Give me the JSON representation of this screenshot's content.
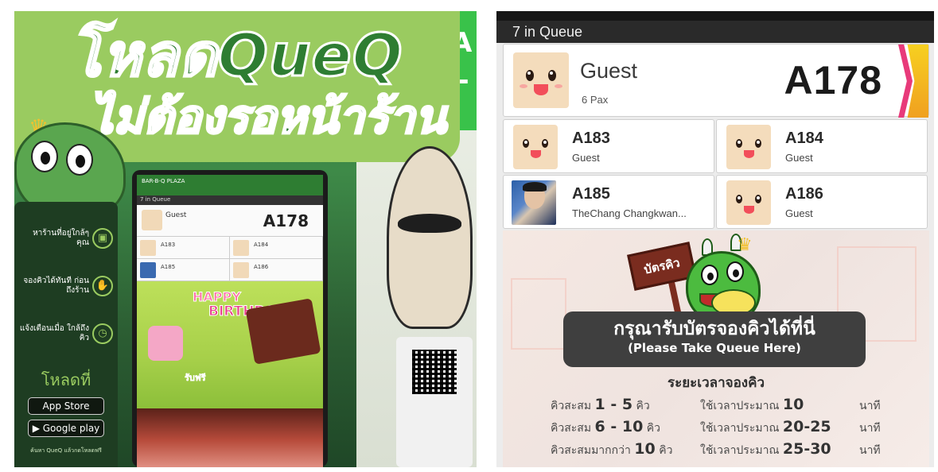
{
  "left_photo": {
    "headline_line1": "โหลดQueQ",
    "headline_line2": "ไม่ต้องรอหน้าร้าน",
    "partial_sign": "A\nL",
    "side_items": [
      {
        "text": "หาร้านที่อยู่ใกล้ๆ คุณ",
        "icon": "store-icon"
      },
      {
        "text": "จองคิวได้ทันที ก่อนถึงร้าน",
        "icon": "hand-icon"
      },
      {
        "text": "แจ้งเตือนเมื่อ ใกล้ถึงคิว",
        "icon": "clock-icon"
      }
    ],
    "download_title": "โหลดที่",
    "app_store": "App Store",
    "google_play": "Google play",
    "footer_text": "ค้นหา QueQ แล้วกดโหลดฟรี",
    "tablet": {
      "brand": "BAR-B-Q PLAZA",
      "queue_label": "7 in Queue",
      "main_name": "Guest",
      "main_number": "A178",
      "cells": [
        {
          "id": "A183",
          "name": "Guest"
        },
        {
          "id": "A184",
          "name": "Guest"
        },
        {
          "id": "A185",
          "name": "TheChang Changkwan..."
        },
        {
          "id": "A186",
          "name": "Guest"
        }
      ],
      "happy": "HAPPY",
      "birthday": "BIRTHDAY",
      "free_text": "รับฟรี"
    }
  },
  "right_screen": {
    "queue_label": "7 in Queue",
    "main_entry": {
      "name": "Guest",
      "pax": "6 Pax",
      "number": "A178"
    },
    "entries": [
      {
        "id": "A183",
        "name": "Guest",
        "avatar": "face-icon"
      },
      {
        "id": "A184",
        "name": "Guest",
        "avatar": "face-icon"
      },
      {
        "id": "A185",
        "name": "TheChang Changkwan...",
        "avatar": "user-photo"
      },
      {
        "id": "A186",
        "name": "Guest",
        "avatar": "face-icon"
      }
    ],
    "sign_text": "บัตรคิว",
    "take_queue_th": "กรุณารับบัตรจองคิวได้ที่นี่",
    "take_queue_en": "(Please Take Queue Here)",
    "wait_title": "ระยะเวลาจองคิว",
    "wait_rows": [
      {
        "queue_prefix": "คิวสะสม",
        "queue_range": "1 - 5",
        "queue_unit": "คิว",
        "time_prefix": "ใช้เวลาประมาณ",
        "time_value": "10",
        "time_unit": "นาที"
      },
      {
        "queue_prefix": "คิวสะสม",
        "queue_range": "6 - 10",
        "queue_unit": "คิว",
        "time_prefix": "ใช้เวลาประมาณ",
        "time_value": "20-25",
        "time_unit": "นาที"
      },
      {
        "queue_prefix": "คิวสะสมมากกว่า",
        "queue_range": "10",
        "queue_unit": "คิว",
        "time_prefix": "ใช้เวลาประมาณ",
        "time_value": "25-30",
        "time_unit": "นาที"
      }
    ]
  },
  "colors": {
    "queue_bar": "#2a2a2a",
    "brand_green": "#2e7d32",
    "ribbon_yellow": "#f7d020",
    "ribbon_pink": "#e83a7a"
  }
}
